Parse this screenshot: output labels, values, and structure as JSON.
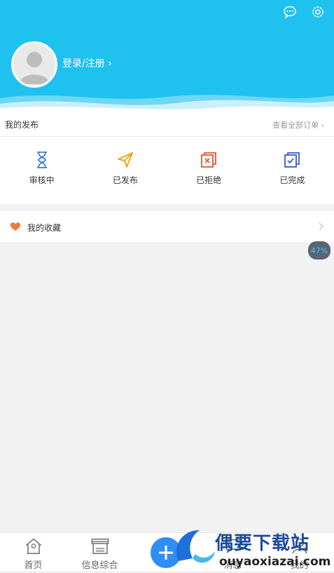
{
  "header": {
    "login_label": "登录/注册 ›"
  },
  "icons": {
    "message": "message-icon",
    "settings": "gear-icon",
    "avatar": "avatar-placeholder"
  },
  "publish": {
    "title": "我的发布",
    "see_all": "查看全部订单 ›",
    "items": [
      {
        "label": "审核中",
        "icon": "hourglass-icon",
        "color": "#3a7bd5"
      },
      {
        "label": "已发布",
        "icon": "paper-plane-icon",
        "color": "#f0a30a"
      },
      {
        "label": "已拒绝",
        "icon": "rejected-doc-icon",
        "color": "#e8562f"
      },
      {
        "label": "已完成",
        "icon": "completed-doc-icon",
        "color": "#3a5bc7"
      }
    ]
  },
  "favorites": {
    "label": "我的收藏",
    "icon": "heart-icon",
    "color": "#f07a3a"
  },
  "badge": {
    "text": "47%"
  },
  "tabbar": {
    "items": [
      {
        "label": "首页",
        "icon": "home-icon"
      },
      {
        "label": "信息综合",
        "icon": "store-icon"
      },
      {
        "label": "",
        "icon": "plus-icon"
      },
      {
        "label": "消息",
        "icon": "chat-icon"
      },
      {
        "label": "我的",
        "icon": "user-icon"
      }
    ]
  },
  "watermark": {
    "title": "偶要下载站",
    "url": "ouyaoxiazai.com"
  },
  "colors": {
    "brand": "#1fc1ef",
    "tab_plus": "#2f8df3"
  }
}
